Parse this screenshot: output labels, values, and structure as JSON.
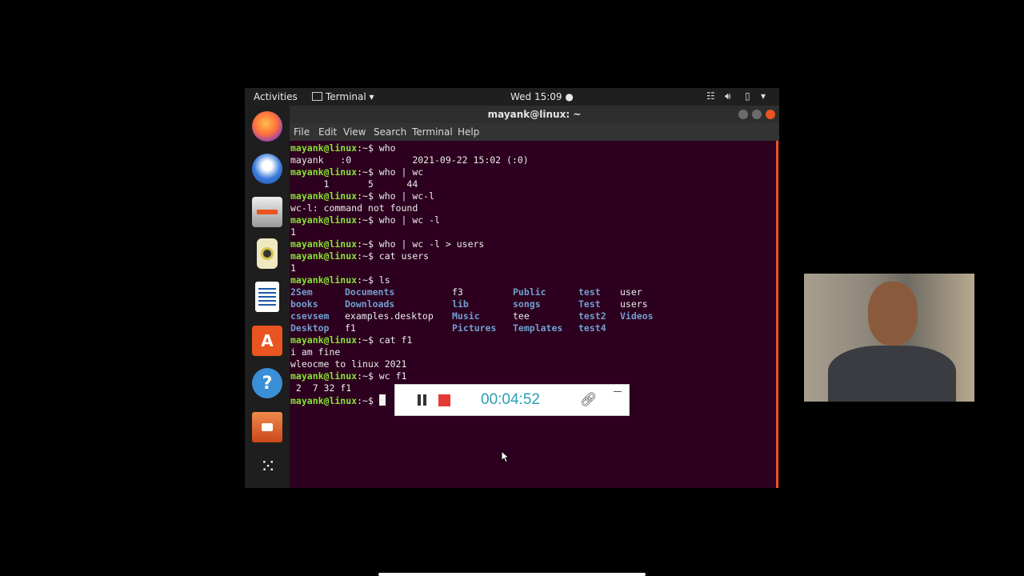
{
  "topbar": {
    "activities": "Activities",
    "app_menu": "Terminal ▾",
    "clock": "Wed 15:09 ●"
  },
  "window": {
    "title": "mayank@linux: ~",
    "menu": [
      "File",
      "Edit",
      "View",
      "Search",
      "Terminal",
      "Help"
    ]
  },
  "terminal": {
    "prompt": "mayank@linux",
    "prompt_suffix": ":~$",
    "lines": [
      {
        "type": "cmd",
        "text": " who"
      },
      {
        "type": "out",
        "text": "mayank   :0           2021-09-22 15:02 (:0)"
      },
      {
        "type": "cmd",
        "text": " who | wc"
      },
      {
        "type": "out",
        "text": "      1       5      44"
      },
      {
        "type": "cmd",
        "text": " who | wc-l"
      },
      {
        "type": "out",
        "text": "wc-l: command not found"
      },
      {
        "type": "cmd",
        "text": " who | wc -l"
      },
      {
        "type": "out",
        "text": "1"
      },
      {
        "type": "cmd",
        "text": " who | wc -l > users"
      },
      {
        "type": "cmd",
        "text": " cat users"
      },
      {
        "type": "out",
        "text": "1"
      },
      {
        "type": "cmd",
        "text": " ls"
      },
      {
        "type": "ls",
        "cells": [
          "2Sem",
          "Documents",
          "f3",
          "Public",
          "test",
          "user"
        ],
        "dirs": [
          true,
          true,
          false,
          true,
          true,
          false
        ]
      },
      {
        "type": "ls",
        "cells": [
          "books",
          "Downloads",
          "lib",
          "songs",
          "Test",
          "users"
        ],
        "dirs": [
          true,
          true,
          true,
          true,
          true,
          false
        ]
      },
      {
        "type": "ls",
        "cells": [
          "csevsem",
          "examples.desktop",
          "Music",
          "tee",
          "test2",
          "Videos"
        ],
        "dirs": [
          true,
          false,
          true,
          false,
          true,
          true
        ]
      },
      {
        "type": "ls",
        "cells": [
          "Desktop",
          "f1",
          "Pictures",
          "Templates",
          "test4",
          ""
        ],
        "dirs": [
          true,
          false,
          true,
          true,
          true,
          false
        ]
      },
      {
        "type": "cmd",
        "text": " cat f1"
      },
      {
        "type": "out",
        "text": "i am fine"
      },
      {
        "type": "out",
        "text": "wleocme to linux 2021"
      },
      {
        "type": "cmd",
        "text": " wc f1"
      },
      {
        "type": "out",
        "text": " 2  7 32 f1"
      },
      {
        "type": "cmd",
        "text": " "
      }
    ]
  },
  "recorder": {
    "time": "00:04:52"
  },
  "dock": [
    "firefox-icon",
    "thunderbird-icon",
    "files-icon",
    "rhythmbox-icon",
    "writer-icon",
    "software-icon",
    "help-icon",
    "folder-icon",
    "apps-grid-icon"
  ],
  "colors": {
    "terminal_bg": "#2c001e",
    "prompt": "#8ae234",
    "directory": "#729fcf",
    "accent": "#e95420",
    "timer": "#2a9fb4"
  }
}
